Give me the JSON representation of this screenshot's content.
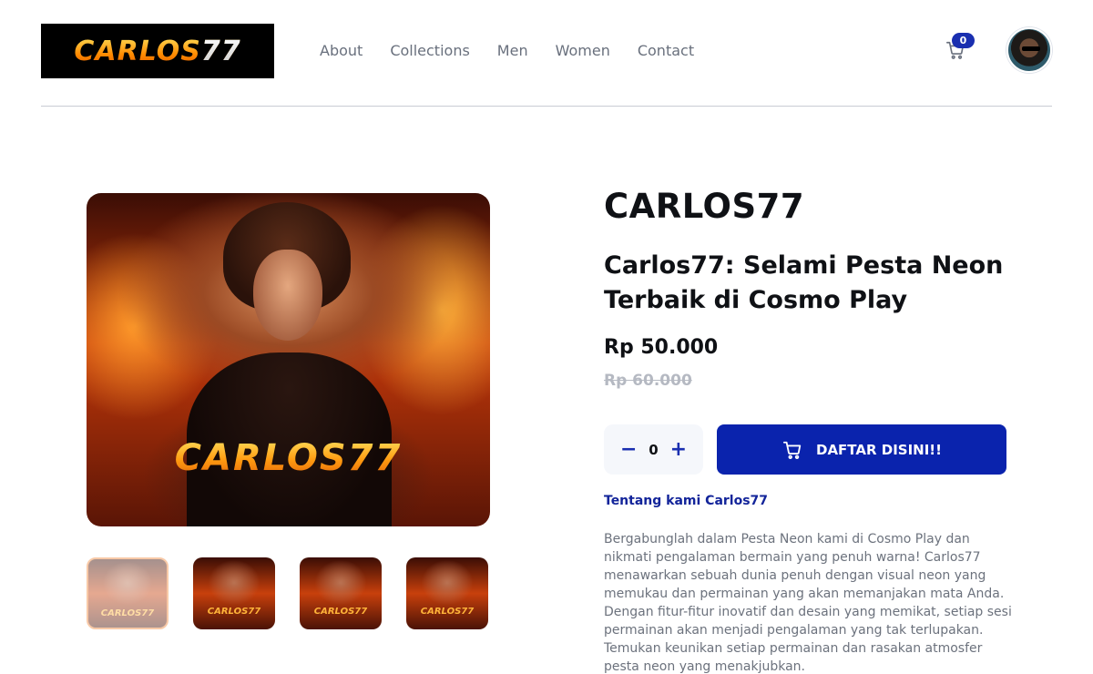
{
  "header": {
    "logo_text_main": "CARLOS",
    "logo_text_tail": "77",
    "nav": [
      "About",
      "Collections",
      "Men",
      "Women",
      "Contact"
    ],
    "cart_count": "0",
    "cart_icon": "cart-icon",
    "avatar_icon": "avatar"
  },
  "gallery": {
    "main_image_logo": "CARLOS77",
    "thumbnails": [
      {
        "label": "CARLOS77",
        "active": true
      },
      {
        "label": "CARLOS77",
        "active": false
      },
      {
        "label": "CARLOS77",
        "active": false
      },
      {
        "label": "CARLOS77",
        "active": false
      }
    ]
  },
  "product": {
    "brand": "CARLOS77",
    "title": "Carlos77: Selami Pesta Neon Terbaik di Cosmo Play",
    "price": "Rp 50.000",
    "old_price": "Rp 60.000",
    "quantity": "0",
    "minus_label": "−",
    "plus_label": "+",
    "cta_label": "DAFTAR DISINI!!",
    "about_link": "Tentang kami Carlos77",
    "description": "Bergabunglah dalam Pesta Neon kami di Cosmo Play dan nikmati pengalaman bermain yang penuh warna! Carlos77 menawarkan sebuah dunia penuh dengan visual neon yang memukau dan permainan yang akan memanjakan mata Anda. Dengan fitur-fitur inovatif dan desain yang memikat, setiap sesi permainan akan menjadi pengalaman yang tak terlupakan. Temukan keunikan setiap permainan dan rasakan atmosfer pesta neon yang menakjubkan."
  },
  "colors": {
    "accent": "#0a23ad",
    "link": "#12249a",
    "thumb_active_border": "#f08a3e",
    "muted_text": "#6c727d"
  }
}
